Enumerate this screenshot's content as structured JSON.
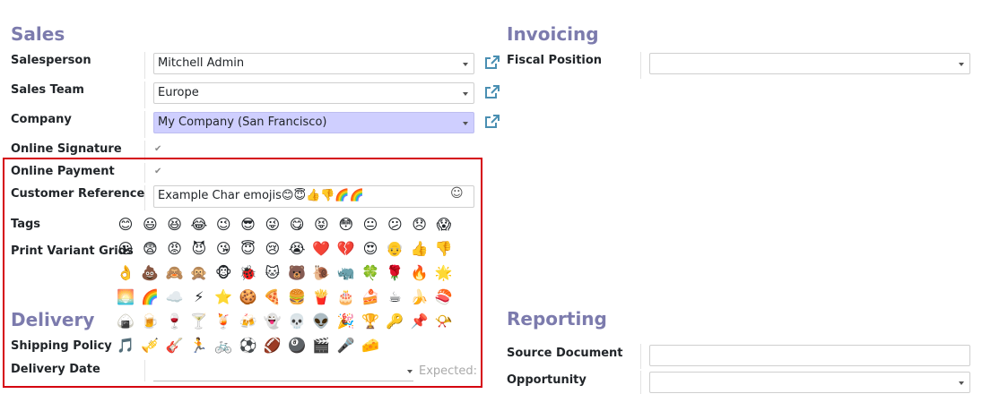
{
  "sales": {
    "title": "Sales",
    "salesperson": {
      "label": "Salesperson",
      "value": "Mitchell Admin"
    },
    "sales_team": {
      "label": "Sales Team",
      "value": "Europe"
    },
    "company": {
      "label": "Company",
      "value": "My Company (San Francisco)"
    },
    "online_signature": {
      "label": "Online Signature",
      "checked": true
    },
    "online_payment": {
      "label": "Online Payment",
      "checked": true
    },
    "customer_reference": {
      "label": "Customer Reference",
      "value": "Example Char emojis😊😇👍👎🌈🌈"
    },
    "tags_label": "Tags",
    "print_variant_grids_label": "Print Variant Grids"
  },
  "invoicing": {
    "title": "Invoicing",
    "fiscal_position": {
      "label": "Fiscal Position",
      "value": ""
    }
  },
  "delivery": {
    "title": "Delivery",
    "shipping_policy_label": "Shipping Policy",
    "delivery_date_label": "Delivery Date",
    "expected_hint": "Expected:"
  },
  "reporting": {
    "title": "Reporting",
    "source_document": {
      "label": "Source Document",
      "value": ""
    },
    "opportunity": {
      "label": "Opportunity",
      "value": ""
    }
  },
  "icons": {
    "external_link": "external-link-icon",
    "emoji_picker": "☺",
    "checkmark": "✔"
  },
  "emoji_picker": {
    "rows": [
      [
        "😊",
        "😃",
        "😆",
        "😂",
        "😉",
        "😎",
        "😜",
        "😋",
        "😝",
        "😳",
        "😐",
        "😕",
        "😞",
        "😱"
      ],
      [
        "😮",
        "😨",
        "😡",
        "😈",
        "😘",
        "😇",
        "😢",
        "😭",
        "❤️",
        "💔",
        "😍",
        "👴",
        "👍",
        "👎"
      ],
      [
        "👌",
        "💩",
        "🙈",
        "🙊",
        "🐵",
        "🐞",
        "🐱",
        "🐻",
        "🐌",
        "🦏",
        "🍀",
        "🌹",
        "🔥",
        "🌟"
      ],
      [
        "🌅",
        "🌈",
        "☁️",
        "⚡",
        "⭐",
        "🍪",
        "🍕",
        "🍔",
        "🍟",
        "🎂",
        "🍰",
        "☕",
        "🍌",
        "🍣"
      ],
      [
        "🍙",
        "🍺",
        "🍷",
        "🍸",
        "🍹",
        "🍻",
        "👻",
        "💀",
        "👽",
        "🎉",
        "🏆",
        "🔑",
        "📌",
        "📯"
      ],
      [
        "🎵",
        "🎺",
        "🎸",
        "🏃",
        "🚲",
        "⚽",
        "🏈",
        "🎱",
        "🎬",
        "🎤",
        "🧀"
      ]
    ]
  },
  "colors": {
    "section_title": "#7c7bad",
    "highlight": "#cfcfff",
    "annotation_border": "#d5000f",
    "icon_teal": "#4a8fb2"
  }
}
